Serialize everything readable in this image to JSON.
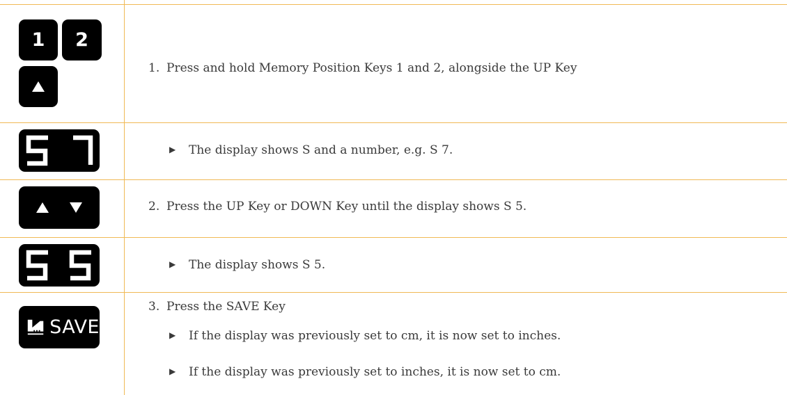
{
  "rows": {
    "row1": {
      "keys": [
        "1",
        "2"
      ],
      "step_number": "1.",
      "step_text": "Press and hold Memory Position Keys 1 and 2, alongside the UP Key"
    },
    "row2": {
      "display": "S 7",
      "result_text": "The display shows S and a number, e.g. S 7."
    },
    "row3": {
      "step_number": "2.",
      "step_text": "Press the UP Key or DOWN Key until the display shows S 5."
    },
    "row4": {
      "display": "S 5",
      "result_text": "The display shows S 5."
    },
    "row5": {
      "save_label": "SAVE",
      "step_number": "3.",
      "step_text": "Press the SAVE Key",
      "results": [
        "If the display was previously set to cm, it is now set to inches.",
        "If the display was previously set to inches, it is now set to cm."
      ]
    }
  },
  "icons": {
    "up": "up-arrow-icon",
    "down": "down-arrow-icon",
    "bullet": "right-triangle-bullet-icon",
    "save_logo": "save-logo-icon"
  },
  "colors": {
    "rule": "#f0b955",
    "key_bg": "#000000",
    "text": "#3a3a3a"
  }
}
